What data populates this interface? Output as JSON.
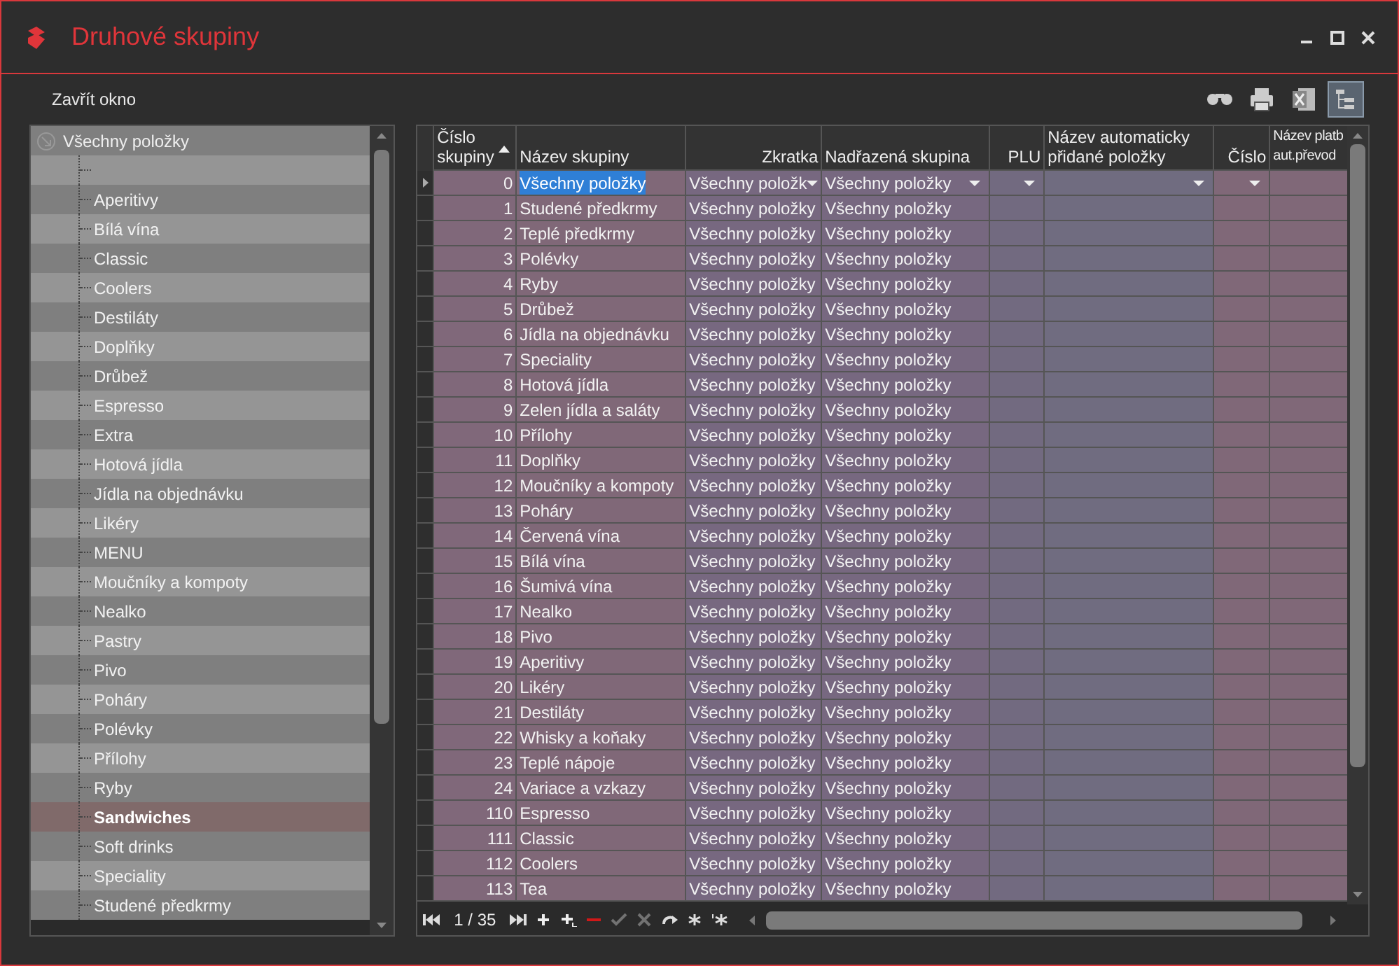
{
  "window": {
    "title": "Druhové skupiny"
  },
  "close_label": "Zavřít okno",
  "toolbar": [
    {
      "kind": "find",
      "pressed": false
    },
    {
      "kind": "print",
      "pressed": false
    },
    {
      "kind": "excel",
      "pressed": false
    },
    {
      "kind": "tree",
      "pressed": true
    }
  ],
  "tree": {
    "label": "Všechny položky",
    "expanded": true,
    "children": [
      {
        "kind": "blank",
        "selected": false
      },
      {
        "kind": "item",
        "label": "Aperitivy",
        "selected": false
      },
      {
        "kind": "item",
        "label": "Bílá vína",
        "selected": false
      },
      {
        "kind": "item",
        "label": "Classic",
        "selected": false
      },
      {
        "kind": "item",
        "label": "Coolers",
        "selected": false
      },
      {
        "kind": "item",
        "label": "Destiláty",
        "selected": false
      },
      {
        "kind": "item",
        "label": "Doplňky",
        "selected": false
      },
      {
        "kind": "item",
        "label": "Drůbež",
        "selected": false
      },
      {
        "kind": "item",
        "label": "Espresso",
        "selected": false
      },
      {
        "kind": "item",
        "label": "Extra",
        "selected": false
      },
      {
        "kind": "item",
        "label": "Hotová jídla",
        "selected": false
      },
      {
        "kind": "item",
        "label": "Jídla na objednávku",
        "selected": false
      },
      {
        "kind": "item",
        "label": "Likéry",
        "selected": false
      },
      {
        "kind": "item",
        "label": "MENU",
        "selected": false
      },
      {
        "kind": "item",
        "label": "Moučníky a kompoty",
        "selected": false
      },
      {
        "kind": "item",
        "label": "Nealko",
        "selected": false
      },
      {
        "kind": "item",
        "label": "Pastry",
        "selected": false
      },
      {
        "kind": "item",
        "label": "Pivo",
        "selected": false
      },
      {
        "kind": "item",
        "label": "Poháry",
        "selected": false
      },
      {
        "kind": "item",
        "label": "Polévky",
        "selected": false
      },
      {
        "kind": "item",
        "label": "Přílohy",
        "selected": false
      },
      {
        "kind": "item",
        "label": "Ryby",
        "selected": false
      },
      {
        "kind": "item",
        "label": "Sandwiches",
        "selected": true
      },
      {
        "kind": "item",
        "label": "Soft drinks",
        "selected": false
      },
      {
        "kind": "item",
        "label": "Speciality",
        "selected": false
      },
      {
        "kind": "item",
        "label": "Studené předkrmy",
        "selected": false
      }
    ]
  },
  "table": {
    "columns": [
      {
        "lines": [
          "Číslo",
          "skupiny"
        ],
        "sorted": true
      },
      {
        "lines": [
          "Název skupiny"
        ],
        "sorted": false
      },
      {
        "lines": [
          "Zkratka"
        ],
        "sorted": false
      },
      {
        "lines": [
          "Nadřazená skupina"
        ],
        "sorted": false
      },
      {
        "lines": [
          "PLU"
        ],
        "sorted": false
      },
      {
        "lines": [
          "Název automaticky",
          "přidané položky"
        ],
        "sorted": false
      },
      {
        "lines": [
          "Číslo"
        ],
        "sorted": false
      },
      {
        "lines": [
          "Název platb",
          "aut.převod"
        ],
        "sorted": false
      }
    ],
    "rows": [
      {
        "number": "0",
        "name": "Všechny položky",
        "short": "Všechny položk",
        "parent": "Všechny položky",
        "selected": true
      },
      {
        "number": "1",
        "name": "Studené předkrmy",
        "short": "Všechny položky",
        "parent": "Všechny položky",
        "selected": false
      },
      {
        "number": "2",
        "name": "Teplé předkrmy",
        "short": "Všechny položky",
        "parent": "Všechny položky",
        "selected": false
      },
      {
        "number": "3",
        "name": "Polévky",
        "short": "Všechny položky",
        "parent": "Všechny položky",
        "selected": false
      },
      {
        "number": "4",
        "name": "Ryby",
        "short": "Všechny položky",
        "parent": "Všechny položky",
        "selected": false
      },
      {
        "number": "5",
        "name": "Drůbež",
        "short": "Všechny položky",
        "parent": "Všechny položky",
        "selected": false
      },
      {
        "number": "6",
        "name": "Jídla na objednávku",
        "short": "Všechny položky",
        "parent": "Všechny položky",
        "selected": false
      },
      {
        "number": "7",
        "name": "Speciality",
        "short": "Všechny položky",
        "parent": "Všechny položky",
        "selected": false
      },
      {
        "number": "8",
        "name": "Hotová jídla",
        "short": "Všechny položky",
        "parent": "Všechny položky",
        "selected": false
      },
      {
        "number": "9",
        "name": "Zelen jídla a saláty",
        "short": "Všechny položky",
        "parent": "Všechny položky",
        "selected": false
      },
      {
        "number": "10",
        "name": "Přílohy",
        "short": "Všechny položky",
        "parent": "Všechny položky",
        "selected": false
      },
      {
        "number": "11",
        "name": "Doplňky",
        "short": "Všechny položky",
        "parent": "Všechny položky",
        "selected": false
      },
      {
        "number": "12",
        "name": "Moučníky a kompoty",
        "short": "Všechny položky",
        "parent": "Všechny položky",
        "selected": false
      },
      {
        "number": "13",
        "name": "Poháry",
        "short": "Všechny položky",
        "parent": "Všechny položky",
        "selected": false
      },
      {
        "number": "14",
        "name": "Červená vína",
        "short": "Všechny položky",
        "parent": "Všechny položky",
        "selected": false
      },
      {
        "number": "15",
        "name": "Bílá vína",
        "short": "Všechny položky",
        "parent": "Všechny položky",
        "selected": false
      },
      {
        "number": "16",
        "name": "Šumivá vína",
        "short": "Všechny položky",
        "parent": "Všechny položky",
        "selected": false
      },
      {
        "number": "17",
        "name": "Nealko",
        "short": "Všechny položky",
        "parent": "Všechny položky",
        "selected": false
      },
      {
        "number": "18",
        "name": "Pivo",
        "short": "Všechny položky",
        "parent": "Všechny položky",
        "selected": false
      },
      {
        "number": "19",
        "name": "Aperitivy",
        "short": "Všechny položky",
        "parent": "Všechny položky",
        "selected": false
      },
      {
        "number": "20",
        "name": "Likéry",
        "short": "Všechny položky",
        "parent": "Všechny položky",
        "selected": false
      },
      {
        "number": "21",
        "name": "Destiláty",
        "short": "Všechny položky",
        "parent": "Všechny položky",
        "selected": false
      },
      {
        "number": "22",
        "name": "Whisky a koňaky",
        "short": "Všechny položky",
        "parent": "Všechny položky",
        "selected": false
      },
      {
        "number": "23",
        "name": "Teplé nápoje",
        "short": "Všechny položky",
        "parent": "Všechny položky",
        "selected": false
      },
      {
        "number": "24",
        "name": "Variace a vzkazy",
        "short": "Všechny položky",
        "parent": "Všechny položky",
        "selected": false
      },
      {
        "number": "110",
        "name": "Espresso",
        "short": "Všechny položky",
        "parent": "Všechny položky",
        "selected": false
      },
      {
        "number": "111",
        "name": "Classic",
        "short": "Všechny položky",
        "parent": "Všechny položky",
        "selected": false
      },
      {
        "number": "112",
        "name": "Coolers",
        "short": "Všechny položky",
        "parent": "Všechny položky",
        "selected": false
      },
      {
        "number": "113",
        "name": "Tea",
        "short": "Všechny položky",
        "parent": "Všechny položky",
        "selected": false
      }
    ]
  },
  "navigator": {
    "position": "1 / 35",
    "buttons": [
      {
        "kind": "first",
        "disabled": false
      },
      {
        "kind": "last",
        "disabled": false
      },
      {
        "kind": "add",
        "disabled": false
      },
      {
        "kind": "add-child",
        "disabled": false
      },
      {
        "kind": "delete",
        "disabled": false
      },
      {
        "kind": "confirm",
        "disabled": true
      },
      {
        "kind": "cancel",
        "disabled": true
      },
      {
        "kind": "refresh",
        "disabled": false
      },
      {
        "kind": "star",
        "disabled": false
      },
      {
        "kind": "star-clear",
        "disabled": false
      }
    ]
  }
}
